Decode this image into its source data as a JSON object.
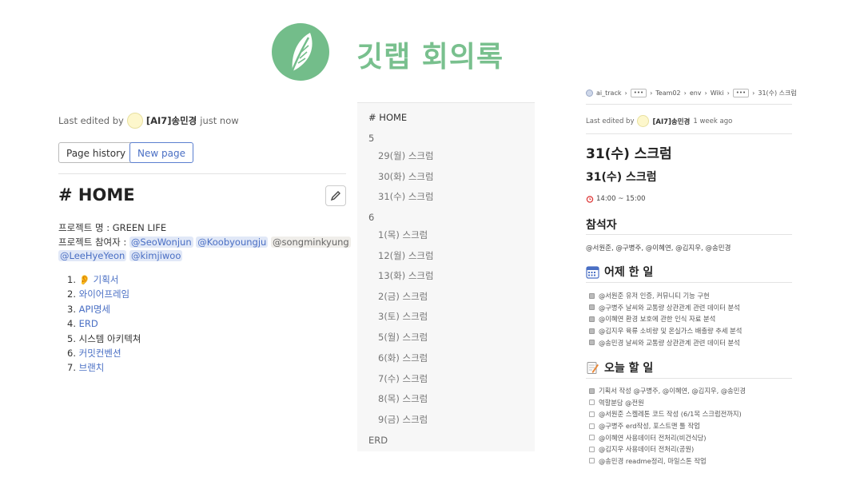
{
  "header": {
    "title": "깃랩 회의록"
  },
  "left": {
    "meta": {
      "prefix": "Last edited by",
      "user": "[AI7]송민경",
      "suffix": "just now"
    },
    "buttons": {
      "page_history": "Page history",
      "new_page": "New page"
    },
    "title": "# HOME",
    "project_name": "프로젝트 명 : GREEN LIFE",
    "participants_label": "프로젝트 참여자 :",
    "participants": [
      "@SeoWonjun",
      "@Koobyoungju",
      "@songminkyung",
      "@LeeHyeYeon",
      "@kimjiwoo"
    ],
    "list": [
      {
        "num": "1.",
        "emoji": "👂",
        "text": "기획서"
      },
      {
        "num": "2.",
        "text": "와이어프레임"
      },
      {
        "num": "3.",
        "text": "API명세"
      },
      {
        "num": "4.",
        "text": "ERD"
      },
      {
        "num": "5.",
        "text": "시스템 아키텍쳐"
      },
      {
        "num": "6.",
        "text": "커밋컨벤션"
      },
      {
        "num": "7.",
        "text": "브랜치"
      }
    ]
  },
  "sidebar": {
    "items": [
      {
        "label": "# HOME",
        "level": 0
      },
      {
        "label": "5",
        "level": 0
      },
      {
        "label": "29(월) 스크럼",
        "level": 1
      },
      {
        "label": "30(화) 스크럼",
        "level": 1
      },
      {
        "label": "31(수) 스크럼",
        "level": 1
      },
      {
        "label": "6",
        "level": 0
      },
      {
        "label": "1(목) 스크럼",
        "level": 1
      },
      {
        "label": "12(월) 스크럼",
        "level": 1
      },
      {
        "label": "13(화) 스크럼",
        "level": 1
      },
      {
        "label": "2(금) 스크럼",
        "level": 1
      },
      {
        "label": "3(토) 스크럼",
        "level": 1
      },
      {
        "label": "5(월) 스크럼",
        "level": 1
      },
      {
        "label": "6(화) 스크럼",
        "level": 1
      },
      {
        "label": "7(수) 스크럼",
        "level": 1
      },
      {
        "label": "8(목) 스크럼",
        "level": 1
      },
      {
        "label": "9(금) 스크럼",
        "level": 1
      },
      {
        "label": "ERD",
        "level": 0
      }
    ]
  },
  "right": {
    "breadcrumb": [
      "ai_track",
      "•••",
      "Team02",
      "env",
      "Wiki",
      "•••",
      "31(수) 스크럼"
    ],
    "meta": {
      "prefix": "Last edited by",
      "user": "[AI7]송민경",
      "suffix": "1 week ago"
    },
    "title": "31(수) 스크럼",
    "subtitle": "31(수) 스크럼",
    "time": "14:00 ~ 15:00",
    "attendees_heading": "참석자",
    "attendees": "@서원준, @구병주, @이혜연, @김지우, @송민경",
    "yesterday_heading": "어제 한 일",
    "yesterday_tasks": [
      {
        "text": "@서원준 유저 인증, 커뮤니티 기능 구현",
        "checked": true
      },
      {
        "text": "@구병주 날씨와 교통량 상관관계 관련 데이터 분석",
        "checked": true
      },
      {
        "text": "@이혜연 환경 보호에 관한 인식 자료 분석",
        "checked": true
      },
      {
        "text": "@김지우 육류 소비량 및 온실가스 배출량 추세 분석",
        "checked": true
      },
      {
        "text": "@송민경 날씨와 교통량 상관관계 관련 데이터 분석",
        "checked": true
      }
    ],
    "today_heading": "오늘 할 일",
    "today_tasks": [
      {
        "text": "기획서 작성 @구병주, @이혜연, @김지우, @송민경",
        "checked": true
      },
      {
        "text": "역할분담 @전원",
        "checked": false
      },
      {
        "text": "@서원준 스켈레톤 코드 작성 (6/1목 스크럼전까지)",
        "checked": false
      },
      {
        "text": "@구병주 erd작성, 포스트맨 툴 작업",
        "checked": false
      },
      {
        "text": "@이혜연 사용데이터 전처리(비건식당)",
        "checked": false
      },
      {
        "text": "@김지우 사용데이터 전처리(공원)",
        "checked": false
      },
      {
        "text": "@송민경 readme정리, 마일스톤 작업",
        "checked": false
      }
    ]
  }
}
